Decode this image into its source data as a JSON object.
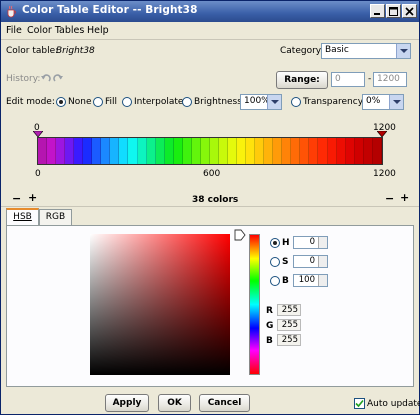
{
  "window": {
    "title": "Color Table Editor -- Bright38"
  },
  "menu": [
    "File",
    "Color Tables",
    "Help"
  ],
  "header": {
    "color_table_label": "Color table:",
    "color_table_name": "Bright38",
    "category_label": "Category:",
    "category_value": "Basic"
  },
  "history": {
    "label": "History:"
  },
  "range": {
    "button": "Range:",
    "min": "0",
    "dash": "-",
    "max": "1200"
  },
  "edit_mode": {
    "label": "Edit mode:",
    "options": [
      "None",
      "Fill",
      "Interpolate",
      "Brightness"
    ],
    "selected": "None",
    "brightness_value": "100%",
    "transparency_label": "Transparency:",
    "transparency_value": "0%"
  },
  "ramp": {
    "top_left_marker": "0",
    "top_right_marker": "1200",
    "axis_labels": [
      "0",
      "600",
      "1200"
    ],
    "color_count": "38 colors",
    "minus": "−",
    "plus": "+",
    "colors": [
      "#b515b0",
      "#c213c9",
      "#9d16e0",
      "#6e19f2",
      "#3a1bff",
      "#1b2cff",
      "#1b5bff",
      "#1b88ff",
      "#17b4ff",
      "#11dcff",
      "#0ff7f0",
      "#0df4c0",
      "#0cf08c",
      "#0cec58",
      "#0deb2a",
      "#19ee10",
      "#3ff20e",
      "#63f50c",
      "#86f70b",
      "#a8f80b",
      "#c8f90b",
      "#e4fa0c",
      "#f9f20c",
      "#ffe20c",
      "#ffcb0b",
      "#ffb30a",
      "#ff9b09",
      "#ff8308",
      "#ff6b07",
      "#ff5306",
      "#ff3d05",
      "#ff2a04",
      "#f91a03",
      "#ed0d02",
      "#df0402",
      "#d00000",
      "#c20000",
      "#b40000"
    ],
    "marker_colors": {
      "left": "#b020b0",
      "right": "#b00000"
    }
  },
  "tabs": [
    {
      "label": "HSB",
      "active": true
    },
    {
      "label": "RGB",
      "active": false
    }
  ],
  "picker": {
    "hsb": [
      {
        "label": "H",
        "value": "0",
        "selected": true
      },
      {
        "label": "S",
        "value": "0",
        "selected": false
      },
      {
        "label": "B",
        "value": "100",
        "selected": false
      }
    ],
    "rgb": [
      {
        "label": "R",
        "value": "255"
      },
      {
        "label": "G",
        "value": "255"
      },
      {
        "label": "B",
        "value": "255"
      }
    ]
  },
  "footer": {
    "apply": "Apply",
    "ok": "OK",
    "cancel": "Cancel",
    "auto_update_label": "Auto update",
    "auto_update_checked": true
  }
}
